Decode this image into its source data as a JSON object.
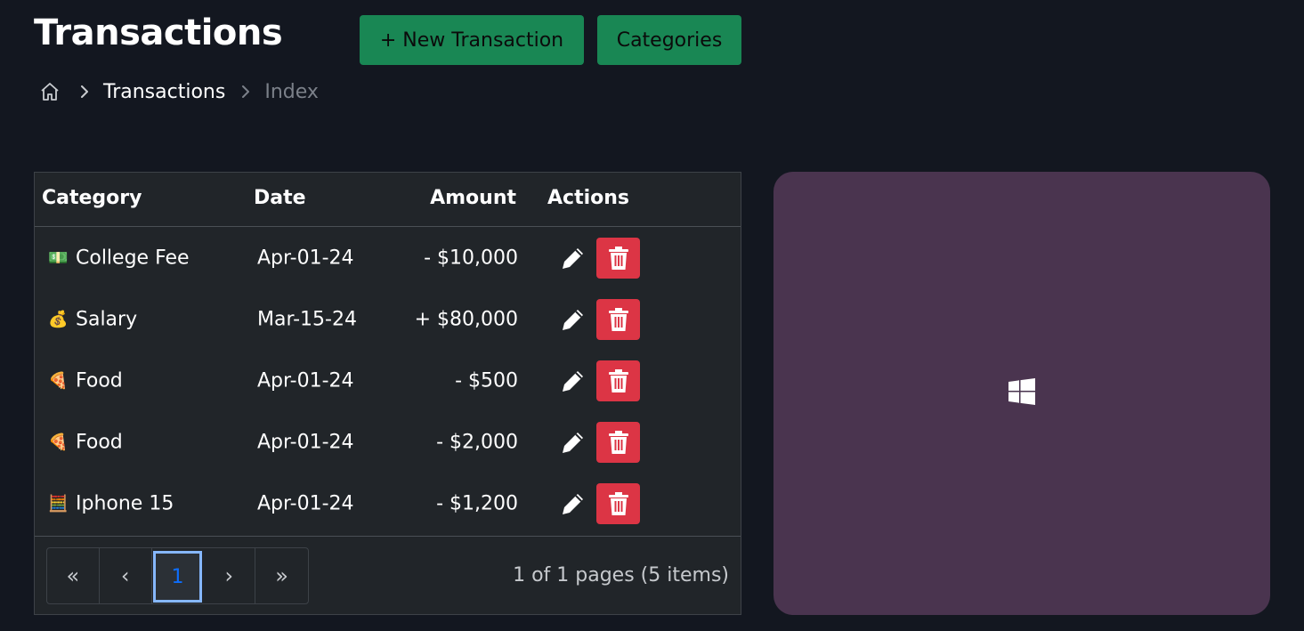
{
  "header": {
    "title": "Transactions",
    "new_button_label": "+ New Transaction",
    "categories_button_label": "Categories"
  },
  "breadcrumb": {
    "home_icon": "home-icon",
    "items": [
      "Transactions",
      "Index"
    ]
  },
  "table": {
    "columns": [
      "Category",
      "Date",
      "Amount",
      "Actions"
    ],
    "rows": [
      {
        "emoji": "💵",
        "category": "College Fee",
        "date": "Apr-01-24",
        "amount": "- $10,000"
      },
      {
        "emoji": "💰",
        "category": "Salary",
        "date": "Mar-15-24",
        "amount": "+ $80,000"
      },
      {
        "emoji": "🍕",
        "category": "Food",
        "date": "Apr-01-24",
        "amount": "- $500"
      },
      {
        "emoji": "🍕",
        "category": "Food",
        "date": "Apr-01-24",
        "amount": "- $2,000"
      },
      {
        "emoji": "🧮",
        "category": "Iphone 15",
        "date": "Apr-01-24",
        "amount": "- $1,200"
      }
    ]
  },
  "pagination": {
    "first": "«",
    "prev": "‹",
    "current": "1",
    "next": "›",
    "last": "»",
    "summary": "1 of 1 pages (5 items)"
  },
  "colors": {
    "background": "#131720",
    "card": "#212529",
    "primary_green": "#198754",
    "danger_red": "#dc3545",
    "panel": "#4a344f",
    "active_page": "#0d6efd"
  },
  "side_panel": {
    "icon": "windows-logo-icon"
  }
}
